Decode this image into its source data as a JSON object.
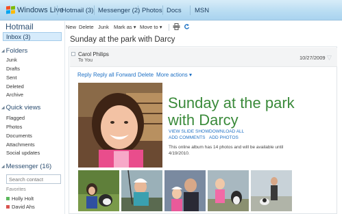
{
  "topnav": {
    "brand": "Windows Live",
    "links": [
      "Hotmail (3)",
      "Messenger (2)",
      "Photos",
      "Docs",
      "MSN"
    ]
  },
  "sidebar": {
    "title": "Hotmail",
    "inbox": "Inbox (3)",
    "folders_heading": "Folders",
    "folders": [
      "Junk",
      "Drafts",
      "Sent",
      "Deleted",
      "Archive"
    ],
    "quickviews_heading": "Quick views",
    "quickviews": [
      "Flagged",
      "Photos",
      "Documents",
      "Attachments",
      "Social updates"
    ],
    "messenger_heading": "Messenger (16)",
    "search_placeholder": "Search contact",
    "favorites_label": "Favorites",
    "contacts": [
      {
        "name": "Holly Holt",
        "status_color": "#5cb85c"
      },
      {
        "name": "David Ahs",
        "status_color": "#d9534f"
      }
    ]
  },
  "toolbar": {
    "new": "New",
    "delete": "Delete",
    "junk": "Junk",
    "mark_as": "Mark as ▾",
    "move_to": "Move to ▾",
    "print_icon": "print-icon",
    "refresh_icon": "refresh-icon"
  },
  "message": {
    "subject": "Sunday at the park with Darcy",
    "sender": "Carol Philips",
    "to": "To You",
    "date": "10/27/2009",
    "actions": [
      "Reply",
      "Reply all",
      "Forward",
      "Delete",
      "More actions ▾"
    ],
    "album_title": "Sunday at the park with Darcy",
    "view_slide_show": "VIEW SLIDE SHOW",
    "download_all": "DOWNLOAD ALL",
    "add_comments": "ADD COMMENTS",
    "add_photos": "ADD PHOTOS",
    "album_note": "This online album has 14 photos and will be available until 4/19/2010."
  },
  "colors": {
    "link": "#1c6fc4",
    "headline": "#3a8a3a",
    "topbar": "#b8dcf2",
    "inbox_highlight": "#d6ebfb"
  }
}
